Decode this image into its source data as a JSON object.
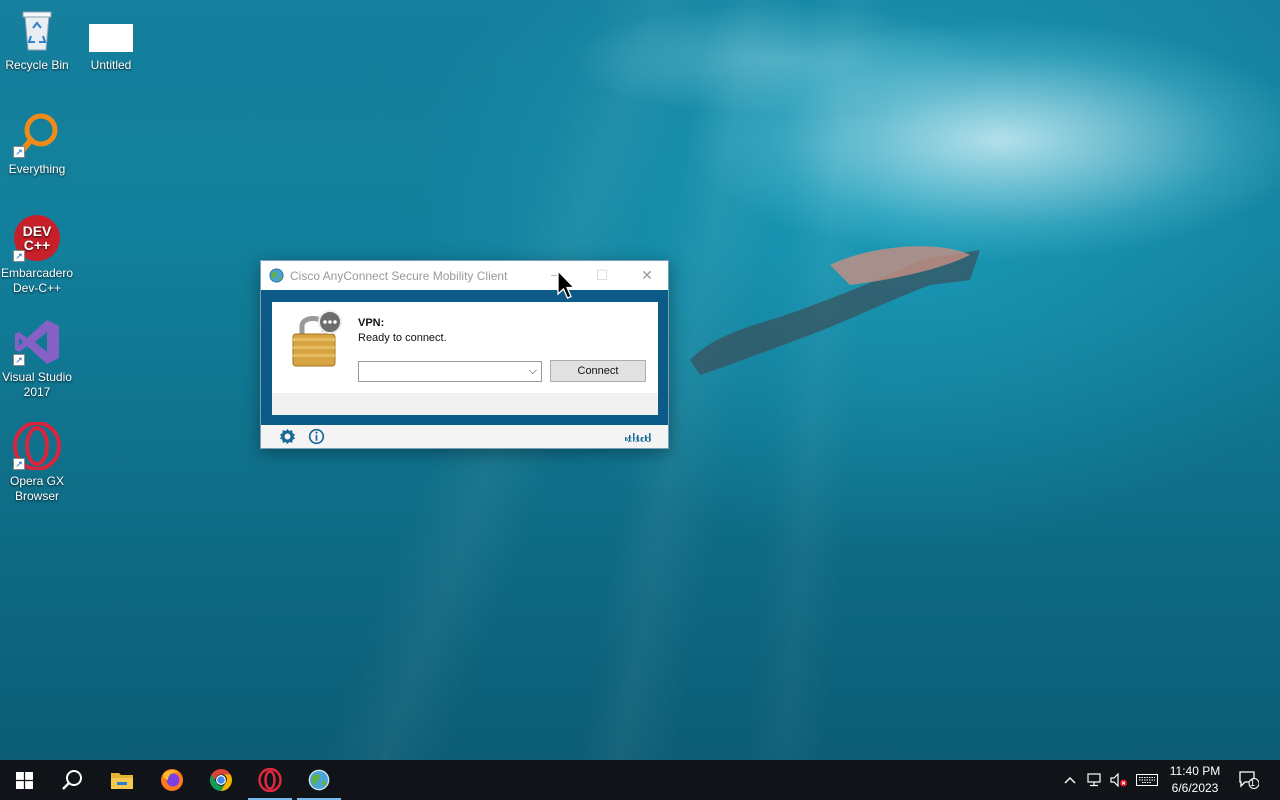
{
  "desktop": {
    "icons": [
      {
        "label": "Recycle Bin"
      },
      {
        "label": "Untitled"
      },
      {
        "label": "Everything"
      },
      {
        "label": "Embarcadero Dev-C++"
      },
      {
        "label": "Visual Studio 2017"
      },
      {
        "label": "Opera GX Browser"
      }
    ]
  },
  "window": {
    "title": "Cisco AnyConnect Secure Mobility Client",
    "minimize_glyph": "—",
    "maximize_glyph": "☐",
    "close_glyph": "✕",
    "vpn_label": "VPN:",
    "status": "Ready to connect.",
    "server_value": "",
    "connect_label": "Connect",
    "brand": "CISCO"
  },
  "taskbar": {
    "apps": [
      "start-icon",
      "search-icon",
      "file-explorer-icon",
      "firefox-icon",
      "chrome-icon",
      "opera-gx-icon",
      "cisco-anyconnect-icon"
    ],
    "clock_time": "11:40 PM",
    "clock_date": "6/6/2023",
    "notification_count": "1"
  },
  "colors": {
    "window_frame": "#0b5a87",
    "taskbar": "#101418",
    "active_indicator": "#76b9ed",
    "cisco_accent": "#1b6a96"
  }
}
